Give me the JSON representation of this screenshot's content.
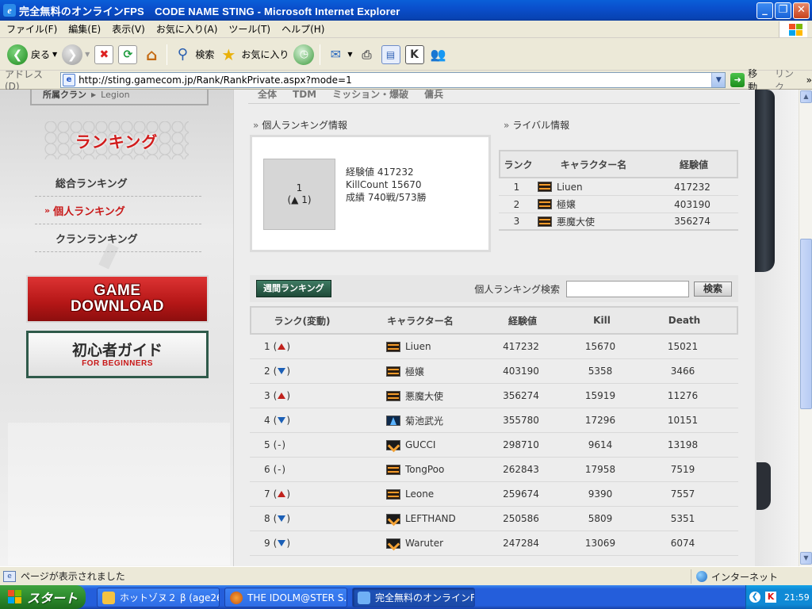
{
  "window": {
    "title": "完全無料のオンラインFPS　CODE NAME STING - Microsoft Internet Explorer",
    "controls": {
      "minimize": "_",
      "maximize": "❐",
      "close": "✕"
    }
  },
  "menubar": {
    "items": [
      "ファイル(F)",
      "編集(E)",
      "表示(V)",
      "お気に入り(A)",
      "ツール(T)",
      "ヘルプ(H)"
    ]
  },
  "toolbar": {
    "back_label": "戻る",
    "search_label": "検索",
    "favorites_label": "お気に入り"
  },
  "addressbar": {
    "label": "アドレス(D)",
    "url": "http://sting.gamecom.jp/Rank/RankPrivate.aspx?mode=1",
    "go_label": "移動",
    "links_label": "リンク",
    "links_chevron": "»"
  },
  "sidebar": {
    "clan_label": "所属クラン",
    "clan_name": "Legion",
    "ranking_heading": "ランキング",
    "nav": [
      {
        "label": "総合ランキング",
        "active": false
      },
      {
        "label": "個人ランキング",
        "active": true,
        "marker": "»"
      },
      {
        "label": "クランランキング",
        "active": false
      }
    ],
    "game_download": [
      "GAME",
      "DOWNLOAD"
    ],
    "beginners_guide": {
      "title": "初心者ガイド",
      "subtitle": "FOR BEGINNERS"
    }
  },
  "main": {
    "tabs": [
      "全体",
      "TDM",
      "ミッション・爆破",
      "傭兵"
    ],
    "personal_info": {
      "title": "個人ランキング情報",
      "rank": "1",
      "change": "(▲ 1)",
      "exp": "経験値 417232",
      "kill_count": "KillCount 15670",
      "record": "成績 740戦/573勝"
    },
    "rival_info": {
      "title": "ライバル情報",
      "columns": [
        "ランク",
        "キャラクター名",
        "経験値"
      ],
      "rows": [
        {
          "rank": "1",
          "name": "Liuen",
          "exp": "417232",
          "icon": "orange"
        },
        {
          "rank": "2",
          "name": "極嬢",
          "exp": "403190",
          "icon": "orange"
        },
        {
          "rank": "3",
          "name": "悪魔大使",
          "exp": "356274",
          "icon": "orange"
        }
      ]
    },
    "weekly_button": "週間ランキング",
    "search": {
      "label": "個人ランキング検索",
      "value": "",
      "button": "検索"
    },
    "ranking_table": {
      "columns": [
        "ランク(変動)",
        "キャラクター名",
        "経験値",
        "Kill",
        "Death"
      ],
      "rows": [
        {
          "rank": "1",
          "trend": "up",
          "name": "Liuen",
          "exp": "417232",
          "kill": "15670",
          "death": "15021",
          "icon": "orange"
        },
        {
          "rank": "2",
          "trend": "down",
          "name": "極嬢",
          "exp": "403190",
          "kill": "5358",
          "death": "3466",
          "icon": "orange"
        },
        {
          "rank": "3",
          "trend": "up",
          "name": "悪魔大使",
          "exp": "356274",
          "kill": "15919",
          "death": "11276",
          "icon": "orange"
        },
        {
          "rank": "4",
          "trend": "down",
          "name": "菊池武光",
          "exp": "355780",
          "kill": "17296",
          "death": "10151",
          "icon": "blue"
        },
        {
          "rank": "5",
          "trend": "flat",
          "name": "GUCCI",
          "exp": "298710",
          "kill": "9614",
          "death": "13198",
          "icon": "chev"
        },
        {
          "rank": "6",
          "trend": "flat",
          "name": "TongPoo",
          "exp": "262843",
          "kill": "17958",
          "death": "7519",
          "icon": "orange"
        },
        {
          "rank": "7",
          "trend": "up",
          "name": "Leone",
          "exp": "259674",
          "kill": "9390",
          "death": "7557",
          "icon": "orange"
        },
        {
          "rank": "8",
          "trend": "down",
          "name": "LEFTHAND",
          "exp": "250586",
          "kill": "5809",
          "death": "5351",
          "icon": "chev"
        },
        {
          "rank": "9",
          "trend": "down",
          "name": "Waruter",
          "exp": "247284",
          "kill": "13069",
          "death": "6074",
          "icon": "chev"
        }
      ]
    }
  },
  "statusbar": {
    "text": "ページが表示されました",
    "zone": "インターネット"
  },
  "taskbar": {
    "start_label": "スタート",
    "tasks": [
      {
        "label": "ホットゾヌ２ β (age26)",
        "active": false
      },
      {
        "label": "THE IDOLM@STER S...",
        "active": false
      },
      {
        "label": "完全無料のオンラインF...",
        "active": true
      }
    ],
    "clock": "21:59"
  },
  "colors": {
    "xp_blue": "#0a4fcc",
    "ranking_red": "#c81818",
    "up_arrow": "#c0211c",
    "down_arrow": "#1b5fb6",
    "weekly_button_green": "#2f5a4a"
  }
}
